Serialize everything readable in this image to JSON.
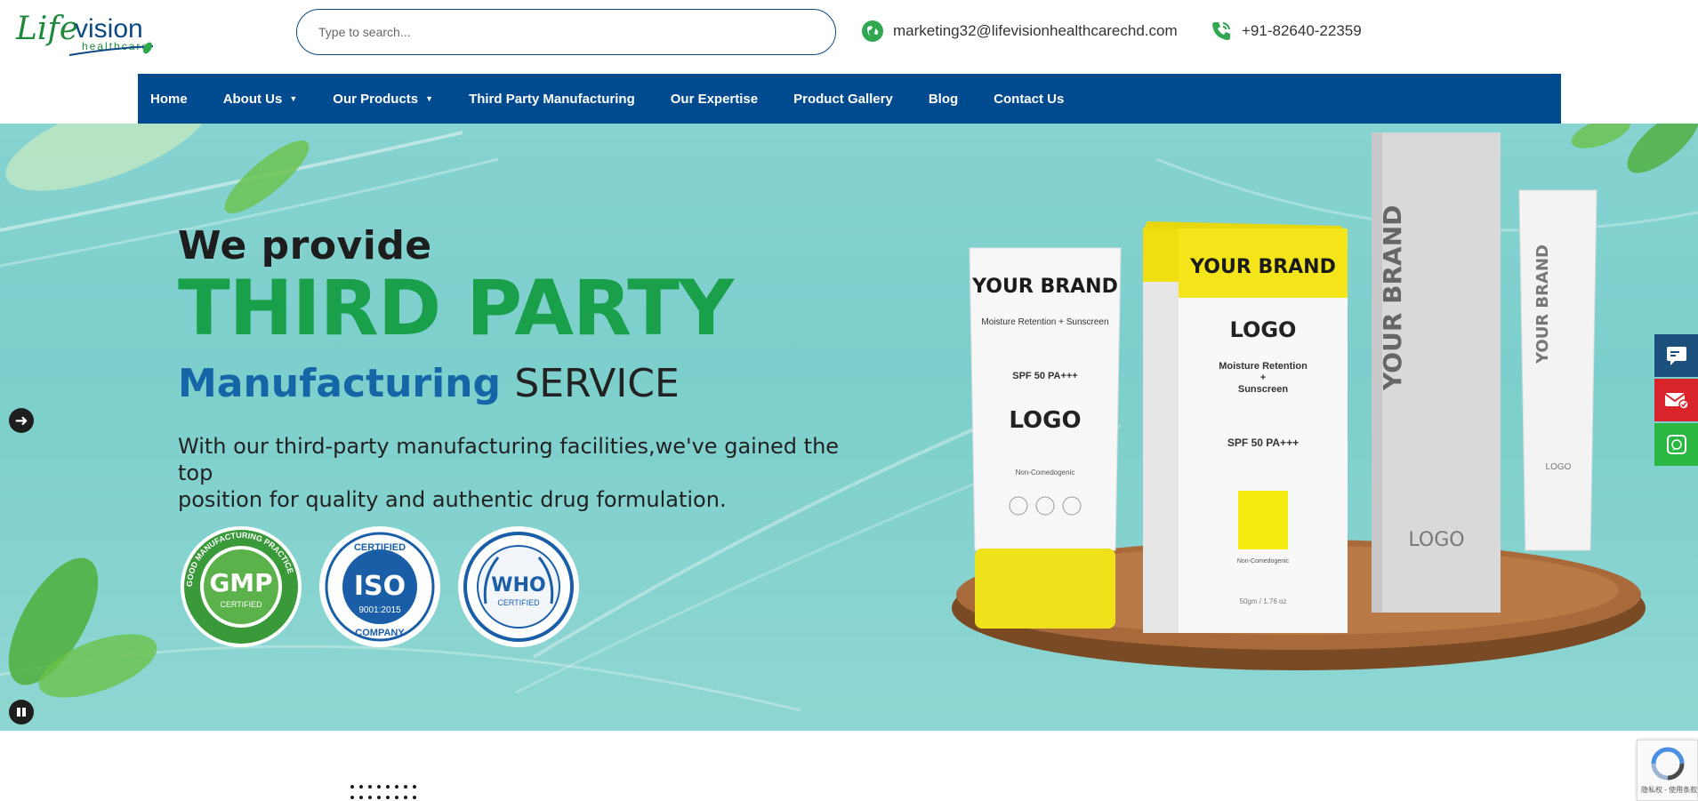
{
  "header": {
    "logo_text_main": "Lifevision",
    "logo_text_sub": "healthcare",
    "search_placeholder": "Type to search...",
    "email": "marketing32@lifevisionhealthcarechd.com",
    "phone": "+91-82640-22359"
  },
  "nav": {
    "items": [
      {
        "label": "Home"
      },
      {
        "label": "About Us",
        "dropdown": true
      },
      {
        "label": "Our Products",
        "dropdown": true
      },
      {
        "label": "Third Party Manufacturing"
      },
      {
        "label": "Our Expertise"
      },
      {
        "label": "Product Gallery"
      },
      {
        "label": "Blog"
      },
      {
        "label": "Contact Us"
      }
    ]
  },
  "hero": {
    "line1": "We provide",
    "line2": "THIRD PARTY",
    "line3_blue": "Manufacturing",
    "line3_dark": "SERVICE",
    "desc_line1": "With our third-party manufacturing facilities,we've gained the top",
    "desc_line2": "position for quality and authentic drug formulation.",
    "badges": {
      "gmp_ring": "GOOD MANUFACTURING PRACTICE",
      "gmp": "GMP",
      "gmp_sub": "CERTIFIED",
      "iso_top": "CERTIFIED",
      "iso": "ISO",
      "iso_num": "9001:2015",
      "iso_bottom": "COMPANY",
      "who": "WHO",
      "who_sub": "CERTIFIED"
    },
    "products": {
      "tube_brand": "YOUR BRAND",
      "tube_desc": "Moisture Retention + Sunscreen",
      "tube_spf": "SPF 50 PA+++",
      "tube_logo": "LOGO",
      "tube_foot": "Non-Comedogenic",
      "box_brand": "YOUR BRAND",
      "box_logo": "LOGO",
      "box_desc1": "Moisture Retention",
      "box_desc2": "+",
      "box_desc3": "Sunscreen",
      "box_spf": "SPF 50 PA+++",
      "box_foot": "Non-Comedogenic",
      "box_size": "50gm / 1.76 oz",
      "tall_brand": "YOUR BRAND",
      "tall_logo": "LOGO",
      "slim_brand": "YOUR BRAND",
      "slim_logo": "LOGO"
    }
  },
  "colors": {
    "nav_bg": "#004a8f",
    "brand_green": "#1aa04b",
    "brand_blue": "#1665a7",
    "hero_bg": "#86d3d1",
    "side_blue": "#1b4f7c",
    "side_red": "#d9242b",
    "side_green": "#2bb741"
  },
  "floating_buttons": [
    "chat-icon",
    "email-icon",
    "whatsapp-icon"
  ],
  "recaptcha_text": "隐私权 - 使用条款"
}
